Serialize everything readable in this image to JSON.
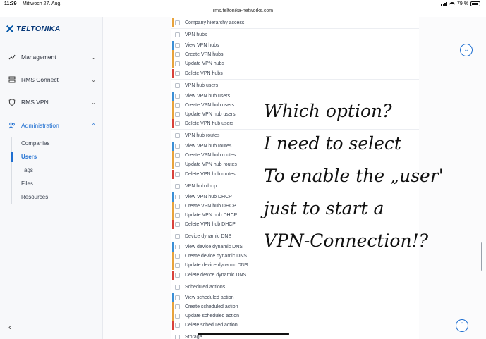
{
  "status_bar": {
    "time": "11:39",
    "date": "Mittwoch 27. Aug.",
    "url": "rms.teltonika-networks.com",
    "battery": "79 %"
  },
  "sidebar": {
    "logo_text": "TELTONIKA",
    "nav": [
      {
        "label": "Management",
        "icon": "management-icon"
      },
      {
        "label": "RMS Connect",
        "icon": "rms-connect-icon"
      },
      {
        "label": "RMS VPN",
        "icon": "shield-icon"
      },
      {
        "label": "Administration",
        "icon": "users-icon",
        "active": true
      }
    ],
    "sub_items": [
      "Companies",
      "Users",
      "Tags",
      "Files",
      "Resources"
    ],
    "active_sub": "Users"
  },
  "colors": {
    "view": "#3b8fd6",
    "create": "#e8a33c",
    "update": "#e8a33c",
    "delete": "#d9423b",
    "accent": "#1f6fd1"
  },
  "permissions": [
    {
      "label": "Company hierarchy access",
      "kind": "update"
    },
    {
      "label": "VPN hubs",
      "kind": "group"
    },
    {
      "label": "View VPN hubs",
      "kind": "view"
    },
    {
      "label": "Create VPN hubs",
      "kind": "create"
    },
    {
      "label": "Update VPN hubs",
      "kind": "update"
    },
    {
      "label": "Delete VPN hubs",
      "kind": "delete"
    },
    {
      "label": "VPN hub users",
      "kind": "group"
    },
    {
      "label": "View VPN hub users",
      "kind": "view"
    },
    {
      "label": "Create VPN hub users",
      "kind": "create"
    },
    {
      "label": "Update VPN hub users",
      "kind": "update"
    },
    {
      "label": "Delete VPN hub users",
      "kind": "delete"
    },
    {
      "label": "VPN hub routes",
      "kind": "group"
    },
    {
      "label": "View VPN hub routes",
      "kind": "view"
    },
    {
      "label": "Create VPN hub routes",
      "kind": "create"
    },
    {
      "label": "Update VPN hub routes",
      "kind": "update"
    },
    {
      "label": "Delete VPN hub routes",
      "kind": "delete"
    },
    {
      "label": "VPN hub dhcp",
      "kind": "group"
    },
    {
      "label": "View VPN hub DHCP",
      "kind": "view"
    },
    {
      "label": "Create VPN hub DHCP",
      "kind": "create"
    },
    {
      "label": "Update VPN hub DHCP",
      "kind": "update"
    },
    {
      "label": "Delete VPN hub DHCP",
      "kind": "delete"
    },
    {
      "label": "Device dynamic DNS",
      "kind": "group"
    },
    {
      "label": "View device dynamic DNS",
      "kind": "view"
    },
    {
      "label": "Create device dynamic DNS",
      "kind": "create"
    },
    {
      "label": "Update device dynamic DNS",
      "kind": "update"
    },
    {
      "label": "Delete device dynamic DNS",
      "kind": "delete"
    },
    {
      "label": "Scheduled actions",
      "kind": "group"
    },
    {
      "label": "View scheduled action",
      "kind": "view"
    },
    {
      "label": "Create scheduled action",
      "kind": "create"
    },
    {
      "label": "Update scheduled action",
      "kind": "update"
    },
    {
      "label": "Delete scheduled action",
      "kind": "delete"
    },
    {
      "label": "Storage",
      "kind": "group"
    }
  ],
  "handwritten_note": [
    "Which option?",
    "I need to select",
    "To enable the „user'",
    "just to start a",
    "VPN-Connection!?"
  ]
}
